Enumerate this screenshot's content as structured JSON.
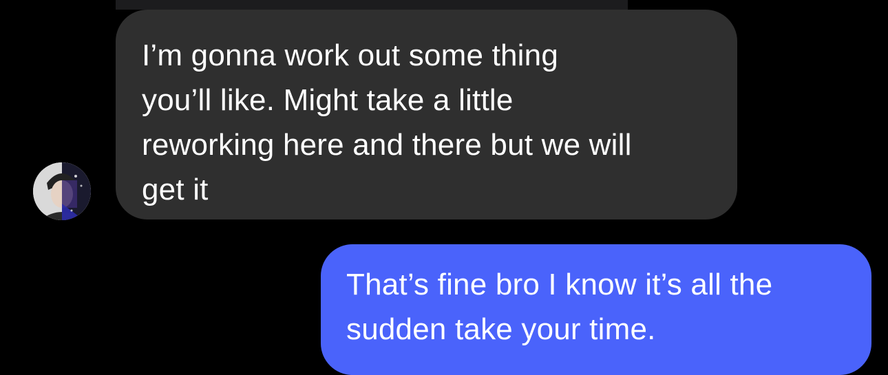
{
  "colors": {
    "background": "#000000",
    "incoming_bubble": "#2f2f2f",
    "outgoing_bubble": "#4a63fb",
    "text": "#ffffff"
  },
  "conversation": {
    "incoming": {
      "sender_avatar": "avatar-icon",
      "lines": [
        "I’m gonna work out some thing",
        "you’ll like. Might take a little",
        "reworking here and there but we will",
        "get it"
      ]
    },
    "outgoing": {
      "lines": [
        "That’s fine bro I know it’s all the",
        "sudden take your time."
      ]
    }
  }
}
